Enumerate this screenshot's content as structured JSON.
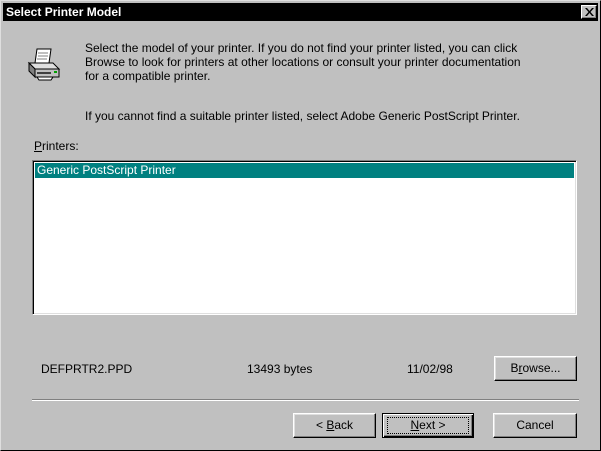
{
  "window": {
    "title": "Select Printer Model"
  },
  "description": {
    "line_block": "Select the model of your printer. If you do not find your printer listed, you can click\nBrowse to look for printers at other locations or consult your printer documentation\nfor a compatible printer.",
    "fallback": "If you cannot find a suitable printer listed, select Adobe Generic PostScript Printer."
  },
  "printers": {
    "label_accel": "P",
    "label_rest": "rinters:",
    "items": [
      {
        "label": "Generic PostScript Printer",
        "selected": true
      }
    ]
  },
  "file_info": {
    "name": "DEFPRTR2.PPD",
    "size": "13493 bytes",
    "date": "11/02/98"
  },
  "buttons": {
    "browse_pre": "B",
    "browse_accel": "r",
    "browse_post": "owse...",
    "back_pre": "< ",
    "back_accel": "B",
    "back_post": "ack",
    "next_accel": "N",
    "next_post": "ext >",
    "cancel": "Cancel"
  },
  "colors": {
    "selection": "#008080",
    "face": "#c0c0c0",
    "titlebar": "#000000"
  },
  "icons": {
    "printer": "printer-icon",
    "close": "close-icon"
  }
}
